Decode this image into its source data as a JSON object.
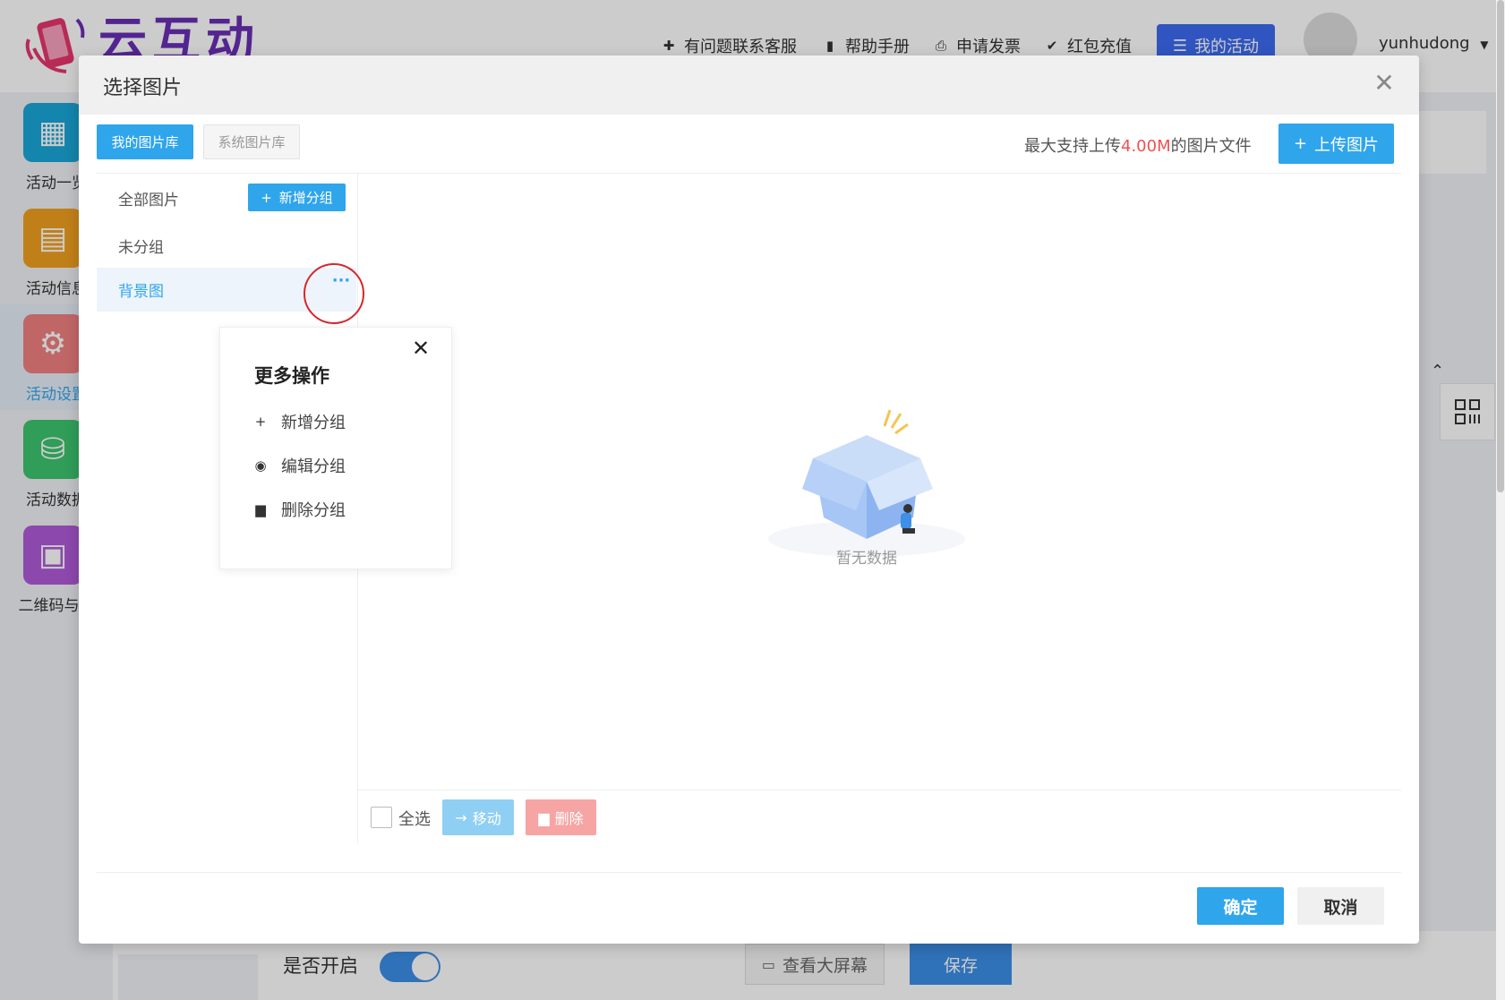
{
  "app": {
    "logo_text": "云互动",
    "nav": [
      {
        "label": "有问题联系客服",
        "icon": "add-user-icon"
      },
      {
        "label": "帮助手册",
        "icon": "book-icon"
      },
      {
        "label": "申请发票",
        "icon": "printer-icon"
      },
      {
        "label": "红包充值",
        "icon": "shield-check-icon"
      }
    ],
    "my_activity": "我的活动",
    "username": "yunhudong",
    "sidebar": [
      {
        "label": "活动一览",
        "icon": "grid-icon",
        "color": "#1aa7d8"
      },
      {
        "label": "活动信息",
        "icon": "document-icon",
        "color": "#f0a020"
      },
      {
        "label": "活动设置",
        "icon": "gear-icon",
        "color": "#f08080",
        "active": true
      },
      {
        "label": "活动数据",
        "icon": "database-icon",
        "color": "#3cc56f"
      },
      {
        "label": "二维码与链",
        "icon": "qrcode-icon",
        "color": "#b05ad8"
      }
    ],
    "bottom": {
      "switch_label": "是否开启",
      "switch_on": true,
      "view_screen": "查看大屏幕",
      "save": "保存"
    }
  },
  "modal": {
    "title": "选择图片",
    "tabs": {
      "mine": "我的图片库",
      "system": "系统图片库"
    },
    "upload_hint_prefix": "最大支持上传",
    "upload_hint_size": "4.00M",
    "upload_hint_suffix": "的图片文件",
    "upload_button": "上传图片",
    "groups": {
      "all": "全部图片",
      "ungrouped": "未分组",
      "background": "背景图",
      "add_group": "新增分组",
      "more": "···"
    },
    "popover": {
      "title": "更多操作",
      "items": [
        {
          "label": "新增分组",
          "icon": "plus-icon"
        },
        {
          "label": "编辑分组",
          "icon": "eye-icon"
        },
        {
          "label": "删除分组",
          "icon": "trash-icon"
        }
      ]
    },
    "empty_text": "暂无数据",
    "select_all": "全选",
    "move": "移动",
    "delete": "删除",
    "confirm": "确定",
    "cancel": "取消"
  },
  "colors": {
    "primary": "#2fa5ec",
    "danger": "#f05050",
    "highlight_ring": "#d6262b",
    "nav_button": "#3d6bf0"
  }
}
